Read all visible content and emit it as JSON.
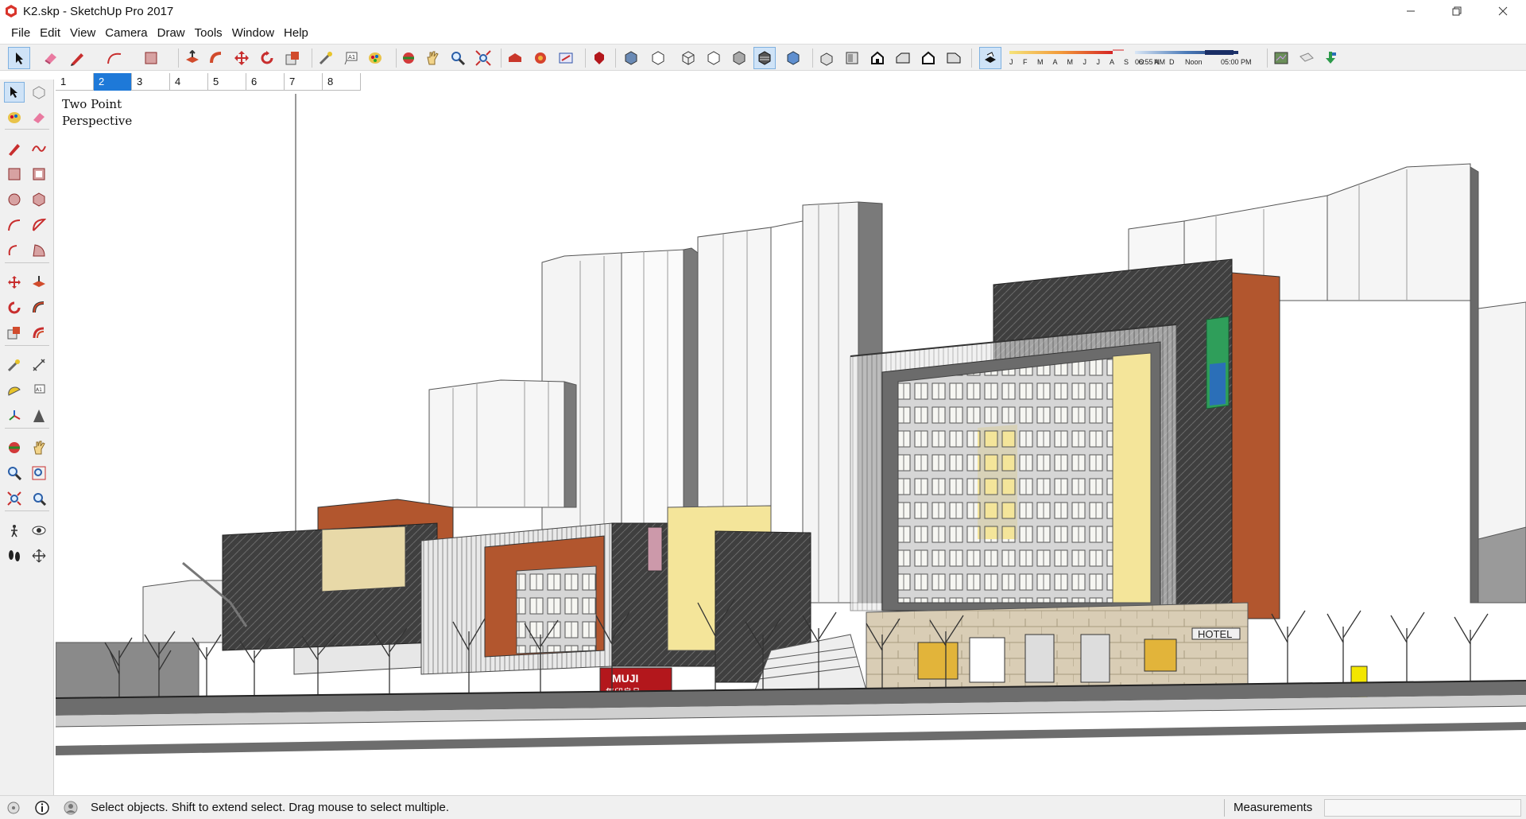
{
  "window": {
    "title": "K2.skp - SketchUp Pro 2017",
    "controls": [
      "minimize-icon",
      "restore-icon",
      "close-icon"
    ]
  },
  "menu": [
    "File",
    "Edit",
    "View",
    "Camera",
    "Draw",
    "Tools",
    "Window",
    "Help"
  ],
  "toolbar": {
    "icons": [
      "select-icon",
      "eraser-icon",
      "pencil-icon",
      "arc-icon",
      "rectangle-icon",
      "push-pull-icon",
      "follow-me-icon",
      "move-icon",
      "rotate-icon",
      "scale-icon",
      "tape-measure-icon",
      "text-icon",
      "paint-bucket-icon",
      "orbit-icon",
      "pan-icon",
      "zoom-icon",
      "zoom-extents-icon",
      "warehouse-icon",
      "extension-warehouse-icon",
      "layout-icon",
      "ruby-icon",
      "xray-icon",
      "back-edges-icon",
      "wireframe-icon",
      "hidden-line-icon",
      "shaded-icon",
      "shaded-textures-icon",
      "monochrome-icon",
      "iso-view-icon",
      "top-view-icon",
      "front-view-icon",
      "right-view-icon",
      "back-view-icon",
      "left-view-icon",
      "shadows-icon",
      "geo-location-icon",
      "add-location-icon",
      "import-icon"
    ],
    "shadow_months": "J F M A M J J A S O N D",
    "time_start": "06:55 AM",
    "time_noon": "Noon",
    "time_end": "05:00 PM"
  },
  "scenes": {
    "tabs": [
      "1",
      "2",
      "3",
      "4",
      "5",
      "6",
      "7",
      "8"
    ],
    "active_index": 1
  },
  "left_toolbar": {
    "icons": [
      "select-icon",
      "component-icon",
      "paint-bucket-icon",
      "eraser-icon",
      "pencil-icon",
      "freehand-icon",
      "rectangle-icon",
      "rotated-rectangle-icon",
      "circle-icon",
      "polygon-icon",
      "arc-icon",
      "two-point-arc-icon",
      "three-point-arc-icon",
      "pie-icon",
      "move-icon",
      "push-pull-icon",
      "rotate-icon",
      "follow-me-icon",
      "scale-icon",
      "offset-icon",
      "tape-measure-icon",
      "dimension-icon",
      "protractor-icon",
      "text-icon",
      "axes-icon",
      "3d-text-icon",
      "orbit-icon",
      "pan-icon",
      "zoom-icon",
      "zoom-window-icon",
      "zoom-extents-icon",
      "previous-view-icon",
      "position-camera-icon",
      "look-around-icon",
      "walk-icon",
      "section-plane-icon"
    ]
  },
  "viewport": {
    "camera_label_line1": "Two Point",
    "camera_label_line2": "Perspective",
    "signs": {
      "muji": "MUJI",
      "muji_cn": "無印良品",
      "hotel": "HOTEL"
    }
  },
  "status": {
    "icons": [
      "geo-status-icon",
      "info-icon",
      "user-icon"
    ],
    "message": "Select objects. Shift to extend select. Drag mouse to select multiple.",
    "measurements_label": "Measurements",
    "measurements_value": ""
  },
  "colors": {
    "accent": "#1e79d8",
    "toolbar_bg": "#f0f0f0",
    "brick": "#b2562e",
    "dark_facade": "#3a3a3a",
    "glass_yellow": "#f4e59a",
    "hotel_green": "#2f9e5a"
  }
}
